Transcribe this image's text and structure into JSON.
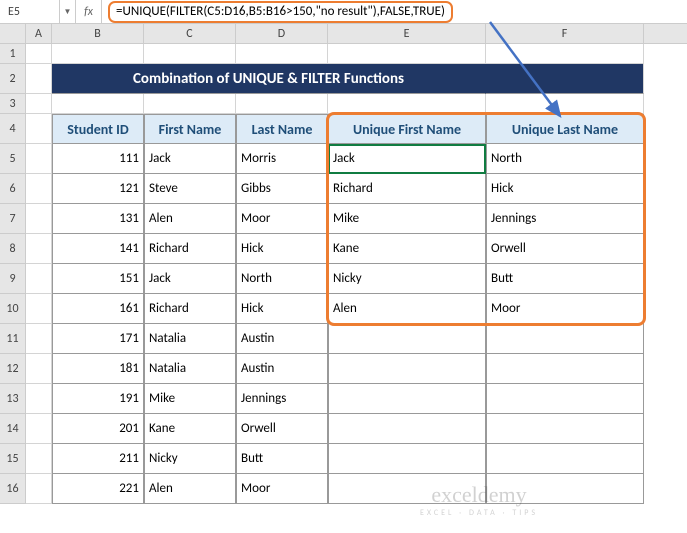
{
  "name_box": "E5",
  "fx_label": "fx",
  "formula": "=UNIQUE(FILTER(C5:D16,B5:B16>150,\"no result\"),FALSE,TRUE)",
  "columns": [
    "A",
    "B",
    "C",
    "D",
    "E",
    "F"
  ],
  "row_numbers": [
    "1",
    "2",
    "3",
    "4",
    "5",
    "6",
    "7",
    "8",
    "9",
    "10",
    "11",
    "12",
    "13",
    "14",
    "15",
    "16"
  ],
  "title": "Combination of UNIQUE & FILTER Functions",
  "headers": {
    "b": "Student ID",
    "c": "First Name",
    "d": "Last Name",
    "e": "Unique First Name",
    "f": "Unique Last Name"
  },
  "rows": [
    {
      "id": "111",
      "first": "Jack",
      "last": "Morris",
      "uf": "Jack",
      "ul": "North"
    },
    {
      "id": "121",
      "first": "Steve",
      "last": "Gibbs",
      "uf": "Richard",
      "ul": "Hick"
    },
    {
      "id": "131",
      "first": "Alen",
      "last": "Moor",
      "uf": "Mike",
      "ul": "Jennings"
    },
    {
      "id": "141",
      "first": "Richard",
      "last": "Hick",
      "uf": "Kane",
      "ul": "Orwell"
    },
    {
      "id": "151",
      "first": "Jack",
      "last": "North",
      "uf": "Nicky",
      "ul": "Butt"
    },
    {
      "id": "161",
      "first": "Richard",
      "last": "Hick",
      "uf": "Alen",
      "ul": "Moor"
    },
    {
      "id": "171",
      "first": "Natalia",
      "last": "Austin",
      "uf": "",
      "ul": ""
    },
    {
      "id": "181",
      "first": "Natalia",
      "last": "Austin",
      "uf": "",
      "ul": ""
    },
    {
      "id": "191",
      "first": "Mike",
      "last": "Jennings",
      "uf": "",
      "ul": ""
    },
    {
      "id": "201",
      "first": "Kane",
      "last": "Orwell",
      "uf": "",
      "ul": ""
    },
    {
      "id": "211",
      "first": "Nicky",
      "last": "Butt",
      "uf": "",
      "ul": ""
    },
    {
      "id": "221",
      "first": "Alen",
      "last": "Moor",
      "uf": "",
      "ul": ""
    }
  ],
  "watermark": {
    "title": "exceldemy",
    "subtitle": "EXCEL · DATA · TIPS"
  }
}
